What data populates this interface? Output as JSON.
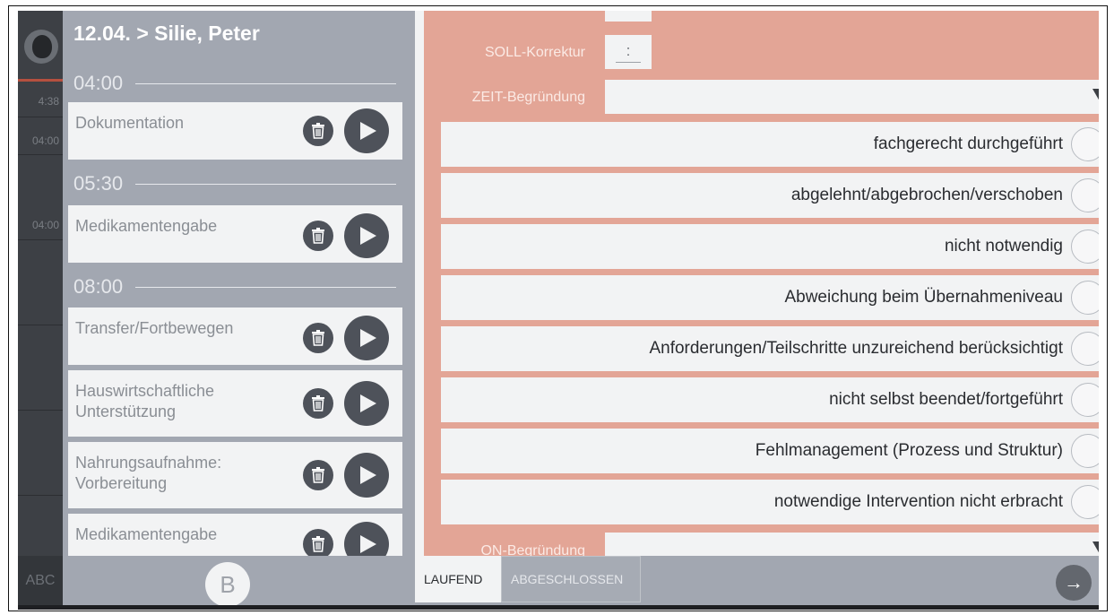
{
  "header": {
    "title": "12.04. > Silie, Peter"
  },
  "strip": {
    "times": [
      "4:38",
      "04:00",
      "04:00"
    ],
    "footer": "ABC"
  },
  "timeline": [
    {
      "time": "04:00",
      "items": [
        {
          "label": "Dokumentation"
        }
      ]
    },
    {
      "time": "05:30",
      "items": [
        {
          "label": "Medikamentengabe"
        }
      ]
    },
    {
      "time": "08:00",
      "items": [
        {
          "label": "Transfer/Fortbewegen"
        },
        {
          "label": "Hauswirtschaftliche Unterstützung"
        },
        {
          "label": "Nahrungsaufnahme: Vorbereitung"
        },
        {
          "label": "Medikamentengabe"
        }
      ]
    }
  ],
  "list_footer": {
    "button_label": "B"
  },
  "detail": {
    "soll_label": "SOLL-Korrektur",
    "soll_value": ":",
    "zeit_label": "ZEIT-Begründung",
    "on_label": "ON-Begründung",
    "options": [
      "fachgerecht durchgeführt",
      "abgelehnt/abgebrochen/verschoben",
      "nicht notwendig",
      "Abweichung beim Übernahmeniveau",
      "Anforderungen/Teilschritte unzureichend berücksichtigt",
      "nicht selbst beendet/fortgeführt",
      "Fehlmanagement (Prozess und Struktur)",
      "notwendige Intervention nicht erbracht"
    ]
  },
  "tabs": {
    "active": "LAUFEND",
    "inactive": "ABGESCHLOSSEN"
  },
  "colors": {
    "panel_grey": "#a2a7b1",
    "salmon": "#e3a596",
    "dark": "#4e525a"
  }
}
